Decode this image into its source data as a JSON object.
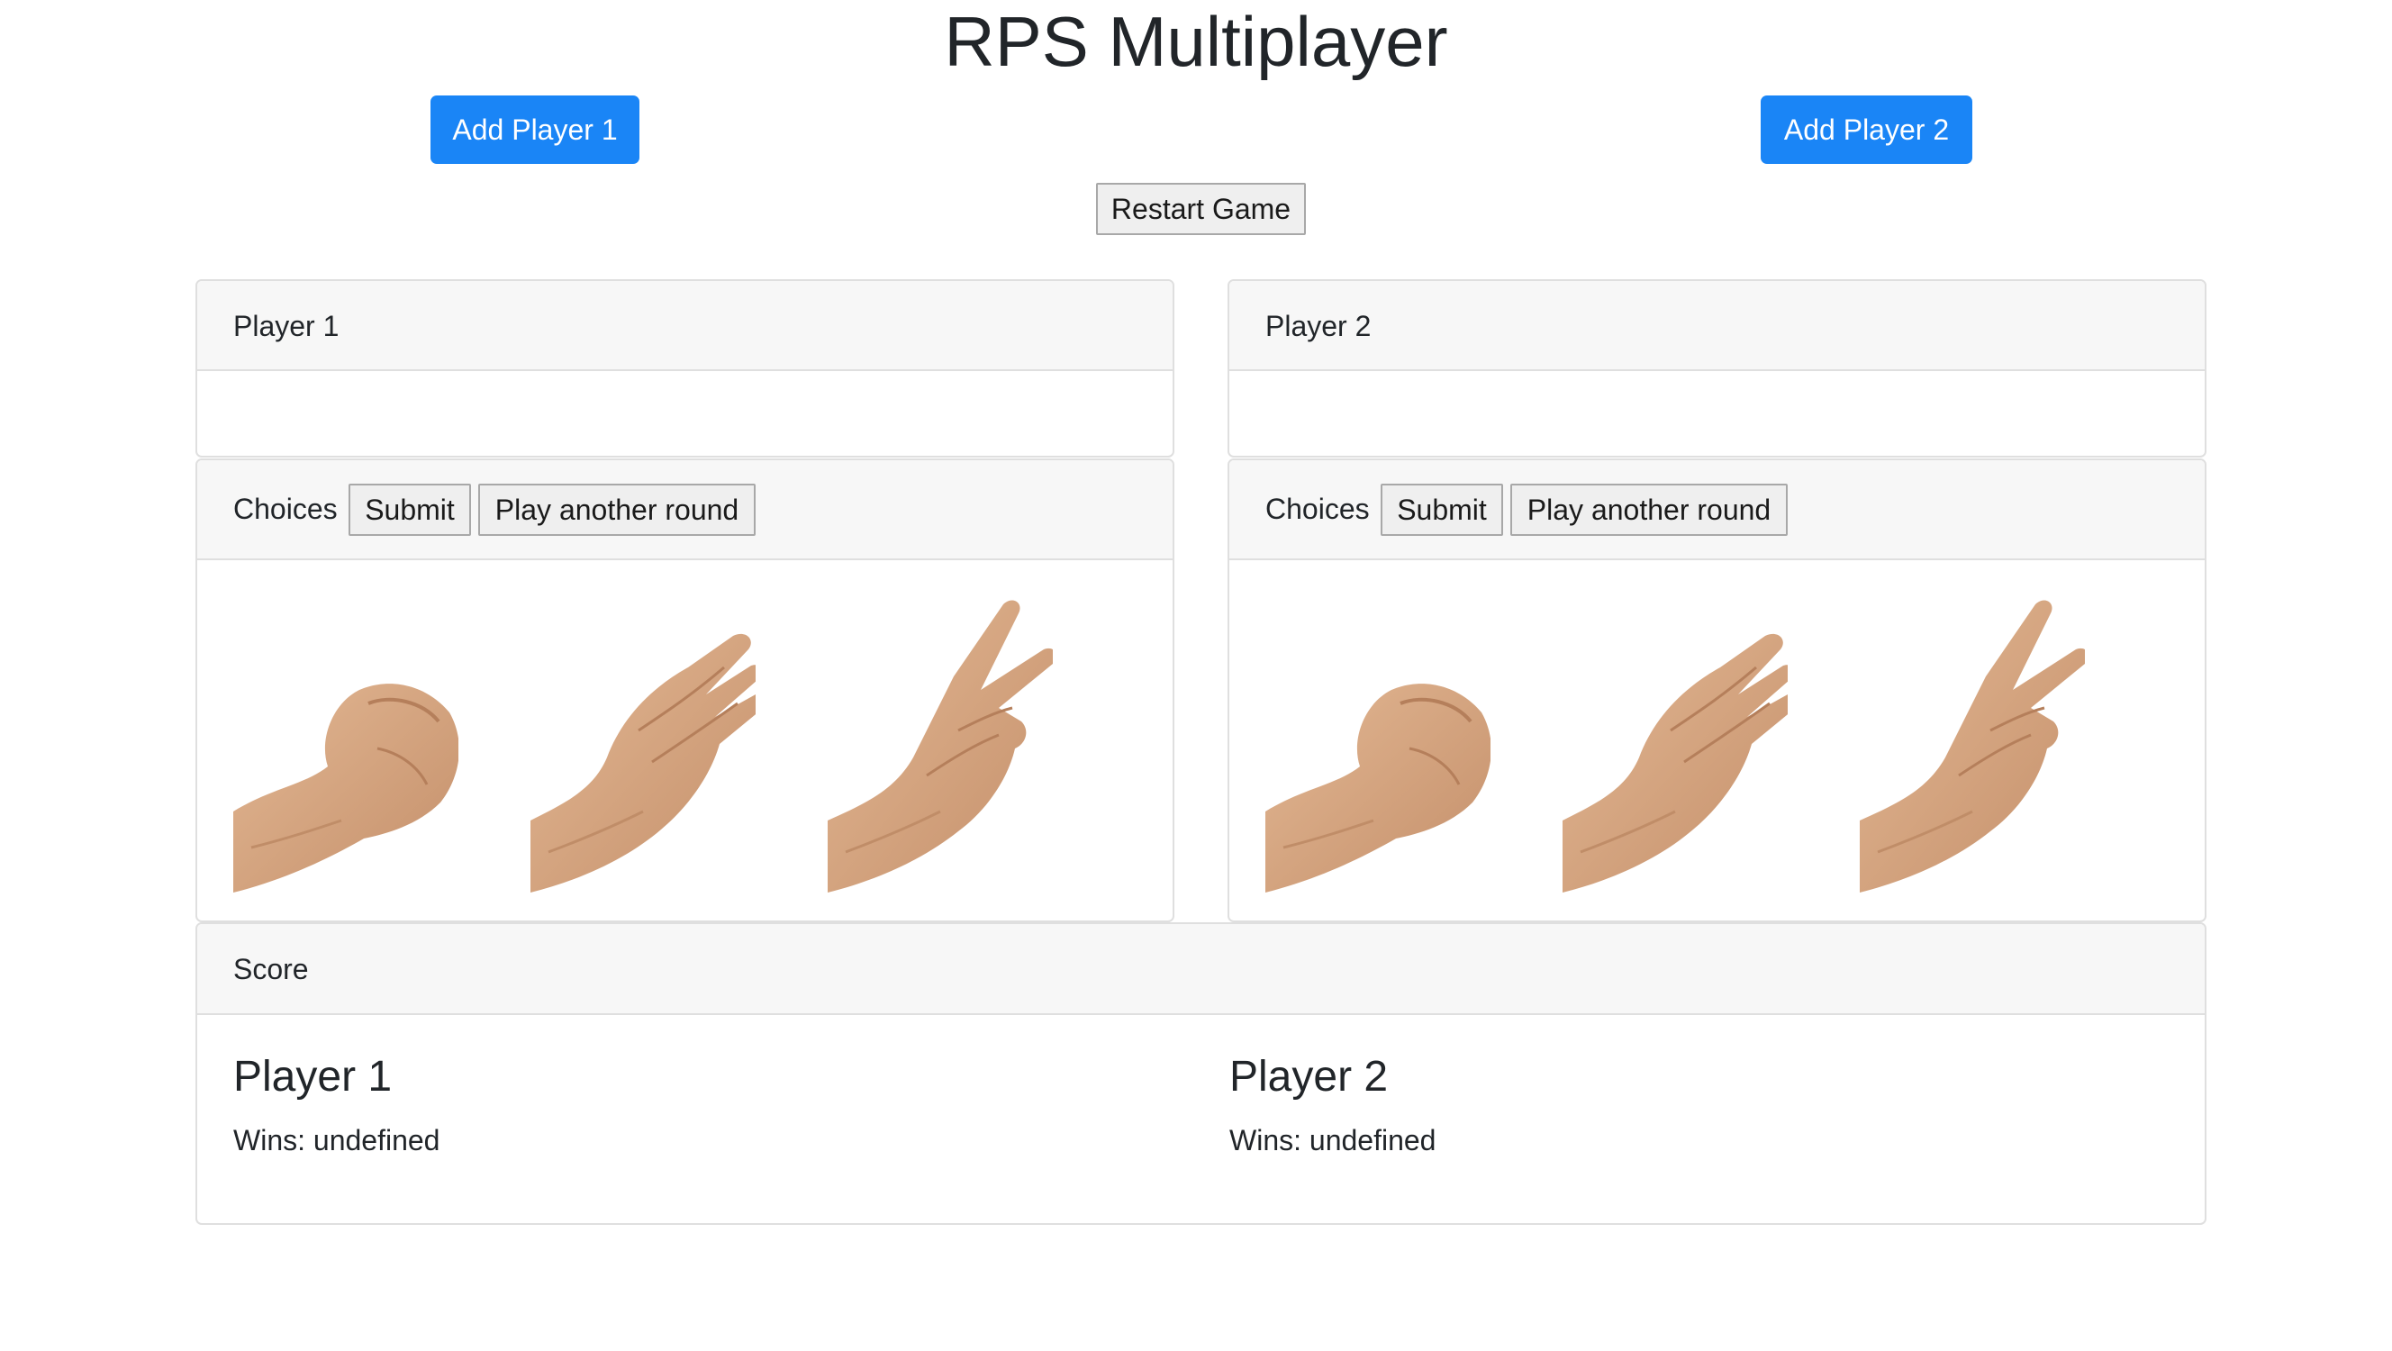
{
  "page": {
    "title": "RPS Multiplayer"
  },
  "buttons": {
    "add_player_1": "Add Player 1",
    "add_player_2": "Add Player 2",
    "restart": "Restart Game"
  },
  "players": [
    {
      "header": "Player 1",
      "choices_label": "Choices",
      "submit_label": "Submit",
      "play_again_label": "Play another round",
      "choices": [
        "rock",
        "paper",
        "scissors"
      ]
    },
    {
      "header": "Player 2",
      "choices_label": "Choices",
      "submit_label": "Submit",
      "play_again_label": "Play another round",
      "choices": [
        "rock",
        "paper",
        "scissors"
      ]
    }
  ],
  "score": {
    "header": "Score",
    "player1_name": "Player 1",
    "player2_name": "Player 2",
    "wins_label": "Wins:",
    "player1_wins": "undefined",
    "player2_wins": "undefined"
  },
  "colors": {
    "primary": "#1a85f6",
    "header_bg": "#f7f7f7",
    "border": "#dfdfdf",
    "skin": "#d7a785"
  }
}
